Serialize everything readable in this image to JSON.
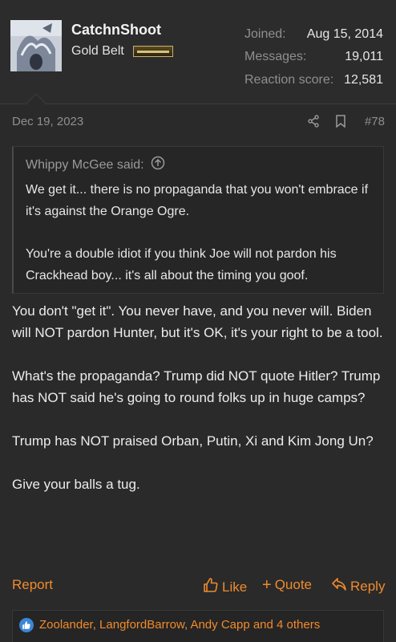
{
  "user": {
    "name": "CatchnShoot",
    "title": "Gold Belt",
    "stats": [
      {
        "label": "Joined:",
        "value": "Aug 15, 2014"
      },
      {
        "label": "Messages:",
        "value": "19,011"
      },
      {
        "label": "Reaction score:",
        "value": "12,581"
      }
    ]
  },
  "post": {
    "date": "Dec 19, 2023",
    "number": "#78",
    "quote": {
      "author": "Whippy McGee said:",
      "paragraphs": [
        "We get it... there is no propaganda that you won't embrace if it's against the Orange Ogre.",
        "You're a double idiot if you think Joe will not pardon his Crackhead boy... it's all about the timing you goof."
      ]
    },
    "paragraphs": [
      "You don't \"get it\". You never have, and you never will. Biden will NOT pardon Hunter, but it's OK, it's your right to be a tool.",
      "What's the propaganda? Trump did NOT quote Hitler? Trump has NOT said he's going to round folks up in huge camps?",
      "Trump has NOT praised Orban, Putin, Xi and Kim Jong Un?",
      "Give your balls a tug."
    ]
  },
  "actions": {
    "report": "Report",
    "like": "Like",
    "quote": "Quote",
    "reply": "Reply"
  },
  "reactions": {
    "text": "Zoolander, LangfordBarrow, Andy Capp and 4 others"
  },
  "colors": {
    "accent": "#f08b2c",
    "background": "#2a2a2a",
    "like_badge": "#3b86d6"
  }
}
